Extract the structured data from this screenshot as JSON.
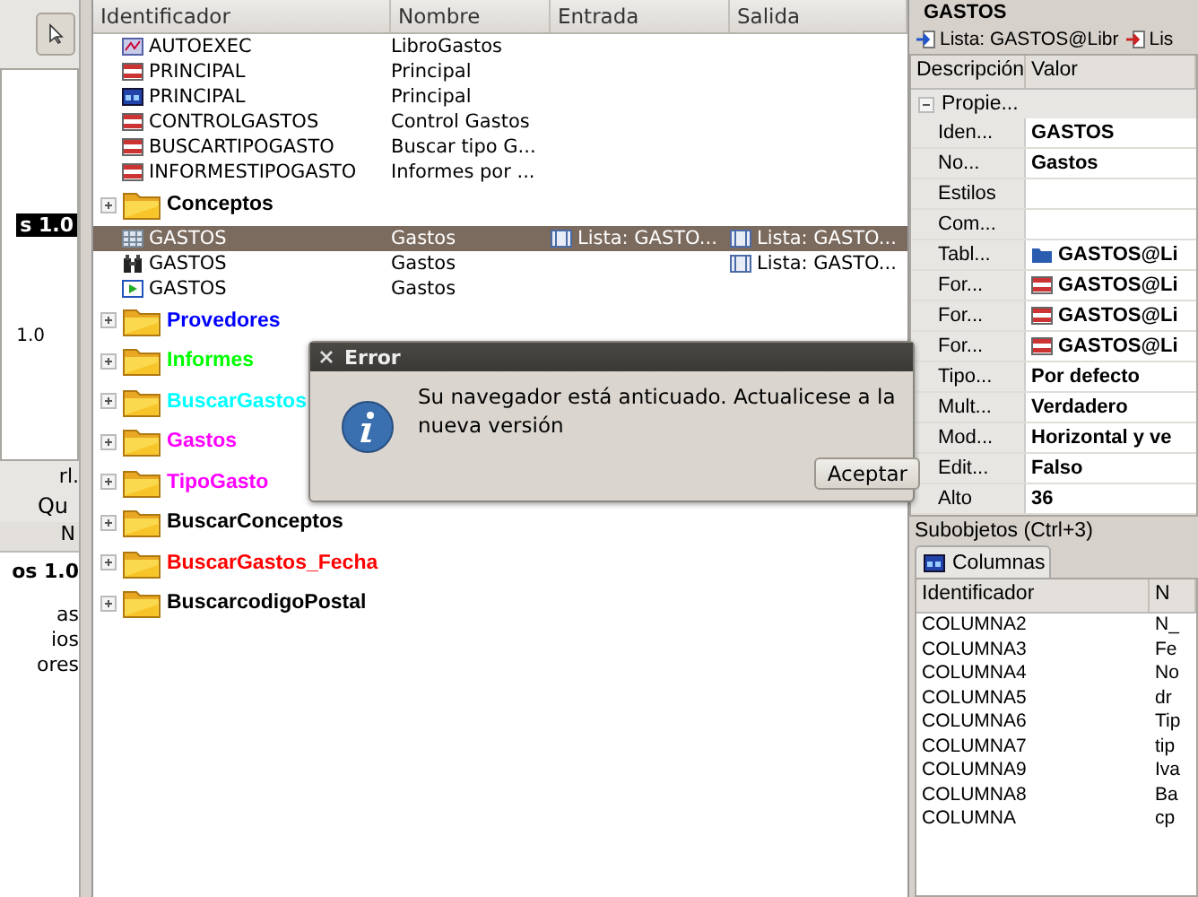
{
  "left_panel": {
    "top_label": "s 1.0",
    "version": "1.0",
    "dock_title": "rl.",
    "tab": "Qu",
    "column_header": "N",
    "items": [
      {
        "text": "os 1.0",
        "bold": true
      },
      {
        "text": "as",
        "bold": false
      },
      {
        "text": "ios",
        "bold": false
      },
      {
        "text": "ores",
        "bold": false
      }
    ]
  },
  "tree": {
    "columns": [
      "Identificador",
      "Nombre",
      "Entrada",
      "Salida"
    ],
    "rows": [
      {
        "kind": "macro",
        "id": "AUTOEXEC",
        "name": "LibroGastos",
        "selected": false
      },
      {
        "kind": "report",
        "id": "PRINCIPAL",
        "name": "Principal",
        "selected": false
      },
      {
        "kind": "form",
        "id": "PRINCIPAL",
        "name": "Principal",
        "selected": false
      },
      {
        "kind": "report",
        "id": "CONTROLGASTOS",
        "name": "Control Gastos",
        "selected": false
      },
      {
        "kind": "report",
        "id": "BUSCARTIPOGASTO",
        "name": "Buscar tipo G...",
        "selected": false
      },
      {
        "kind": "report",
        "id": "INFORMESTIPOGASTO",
        "name": "Informes por ...",
        "selected": false
      },
      {
        "kind": "folder",
        "name": "Conceptos",
        "color": "#000000",
        "expanded": false
      },
      {
        "kind": "table",
        "id": "GASTOS",
        "name": "Gastos",
        "input": "Lista: GASTO...",
        "output": "Lista: GASTO...",
        "selected": true
      },
      {
        "kind": "query",
        "id": "GASTOS",
        "name": "Gastos",
        "output": "Lista: GASTO...",
        "selected": false
      },
      {
        "kind": "run",
        "id": "GASTOS",
        "name": "Gastos",
        "selected": false
      },
      {
        "kind": "folder",
        "name": "Provedores",
        "color": "#0000ff",
        "expanded": false
      },
      {
        "kind": "folder",
        "name": "Informes",
        "color": "#00ff00",
        "expanded": false
      },
      {
        "kind": "folder",
        "name": "BuscarGastos",
        "color": "#00ffff",
        "expanded": false
      },
      {
        "kind": "folder",
        "name": "Gastos",
        "color": "#ff00ff",
        "expanded": false
      },
      {
        "kind": "folder",
        "name": "TipoGasto",
        "color": "#ff00ff",
        "expanded": false
      },
      {
        "kind": "folder",
        "name": "BuscarConceptos",
        "color": "#000000",
        "expanded": false
      },
      {
        "kind": "folder",
        "name": "BuscarGastos_Fecha",
        "color": "#ff0000",
        "expanded": false
      },
      {
        "kind": "folder",
        "name": "BuscarcodigoPostal",
        "color": "#000000",
        "expanded": false
      }
    ]
  },
  "dialog": {
    "title": "Error",
    "message": "Su navegador está anticuado. Actualicese a la nueva versión",
    "button": "Aceptar"
  },
  "inspector": {
    "title": "GASTOS",
    "links": [
      "Lista: GASTOS@Libr",
      "Lis"
    ],
    "columns": [
      "Descripción",
      "Valor"
    ],
    "group": "Propie...",
    "group_expanded": true,
    "properties": [
      {
        "kind": "text",
        "label": "Iden...",
        "value": "GASTOS"
      },
      {
        "kind": "text",
        "label": "No...",
        "value": "Gastos"
      },
      {
        "kind": "text",
        "label": "Estilos"
      },
      {
        "kind": "text",
        "label": "Com..."
      },
      {
        "kind": "table",
        "label": "Tabl...",
        "value": "GASTOS@Li"
      },
      {
        "kind": "form",
        "label": "For...",
        "value": "GASTOS@Li"
      },
      {
        "kind": "form",
        "label": "For...",
        "value": "GASTOS@Li"
      },
      {
        "kind": "form",
        "label": "For...",
        "value": "GASTOS@Li"
      },
      {
        "kind": "text",
        "label": "Tipo...",
        "value": "Por defecto"
      },
      {
        "kind": "text",
        "label": "Mult...",
        "value": "Verdadero"
      },
      {
        "kind": "text",
        "label": "Mod...",
        "value": "Horizontal y ve"
      },
      {
        "kind": "text",
        "label": "Edit...",
        "value": "Falso"
      },
      {
        "kind": "text",
        "label": "Alto",
        "value": "36"
      }
    ]
  },
  "subobjects": {
    "title": "Subobjetos (Ctrl+3)",
    "tab": "Columnas",
    "columns": [
      "Identificador",
      "N"
    ],
    "rows": [
      [
        "COLUMNA2",
        "N_"
      ],
      [
        "COLUMNA3",
        "Fe"
      ],
      [
        "COLUMNA4",
        "No"
      ],
      [
        "COLUMNA5",
        "dr"
      ],
      [
        "COLUMNA6",
        "Tip"
      ],
      [
        "COLUMNA7",
        "tip"
      ],
      [
        "COLUMNA9",
        "Iva"
      ],
      [
        "COLUMNA8",
        "Ba"
      ],
      [
        "COLUMNA",
        "cp"
      ]
    ]
  }
}
